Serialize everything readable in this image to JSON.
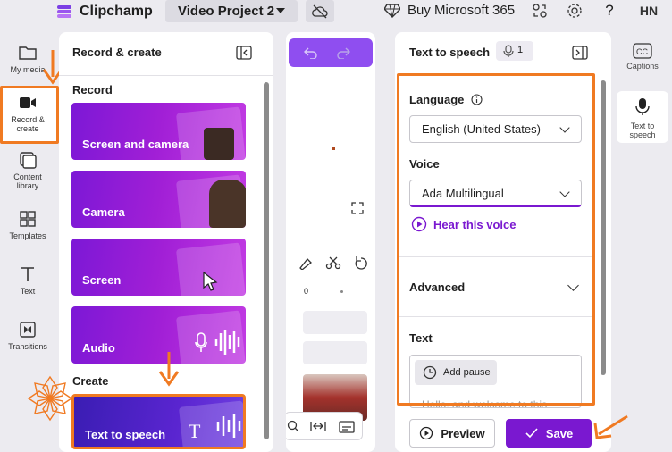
{
  "app": {
    "name": "Clipchamp",
    "project_name": "Video Project 2",
    "buy_label": "Buy Microsoft 365",
    "avatar_initials": "HN"
  },
  "rail": {
    "items": [
      {
        "label": "My media"
      },
      {
        "label": "Record &\ncreate"
      },
      {
        "label": "Content\nlibrary"
      },
      {
        "label": "Templates"
      },
      {
        "label": "Text"
      },
      {
        "label": "Transitions"
      }
    ]
  },
  "record_panel": {
    "title": "Record & create",
    "record_section": "Record",
    "create_section": "Create",
    "cards": [
      {
        "label": "Screen and camera"
      },
      {
        "label": "Camera"
      },
      {
        "label": "Screen"
      },
      {
        "label": "Audio"
      }
    ],
    "create_cards": [
      {
        "label": "Text to speech"
      }
    ]
  },
  "timeline": {
    "ruler_start": "0"
  },
  "tts_panel": {
    "title": "Text to speech",
    "badge_count": "1",
    "language_label": "Language",
    "language_value": "English (United States)",
    "voice_label": "Voice",
    "voice_value": "Ada Multilingual",
    "hear_label": "Hear this voice",
    "advanced_label": "Advanced",
    "text_label": "Text",
    "add_pause_label": "Add pause",
    "text_preview": "Hello, and welcome to this",
    "preview_label": "Preview",
    "save_label": "Save"
  },
  "right_rail": {
    "items": [
      {
        "label": "Captions"
      },
      {
        "label": "Text to\nspeech"
      }
    ]
  },
  "colors": {
    "accent": "#7a18d0",
    "highlight": "#f07a22"
  }
}
